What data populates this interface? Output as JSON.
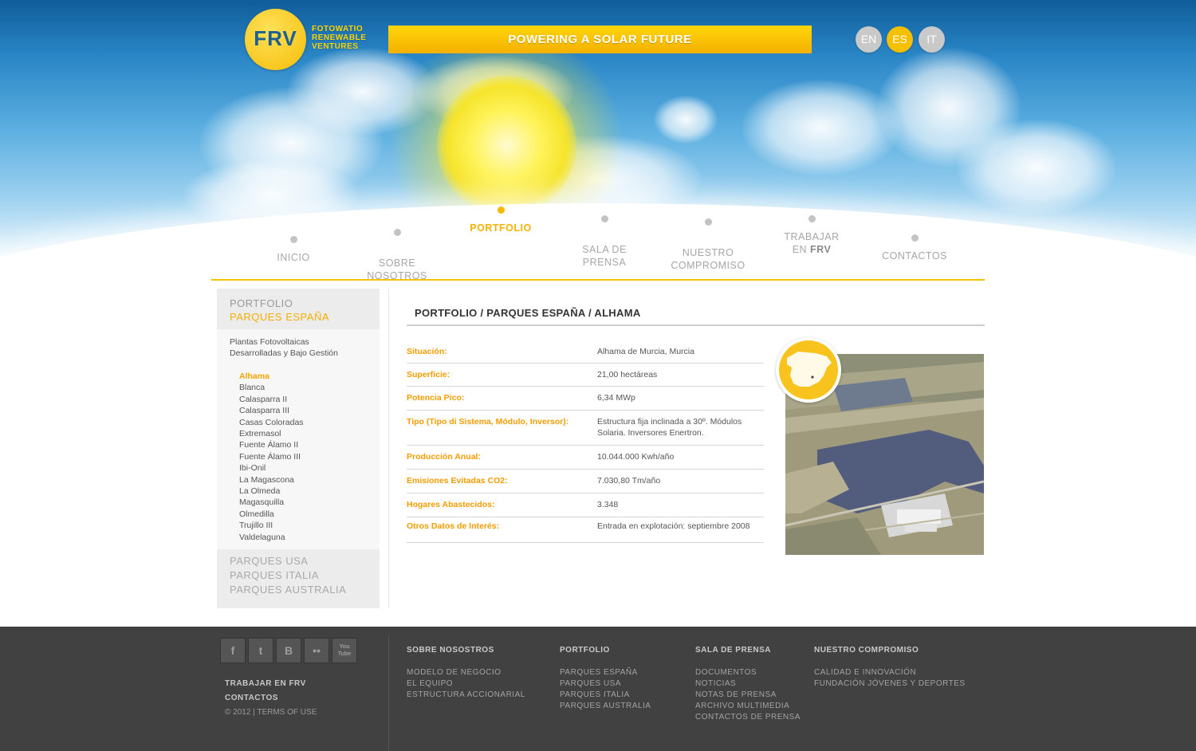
{
  "brand": {
    "mark": "FRV",
    "name_lines": [
      "FOTOWATIO",
      "RENEWABLE",
      "VENTURES"
    ],
    "colors": {
      "yellow": "#f6c000",
      "blue": "#1b5f93"
    }
  },
  "banner": "POWERING A SOLAR FUTURE",
  "languages": [
    {
      "label": "EN",
      "active": false
    },
    {
      "label": "ES",
      "active": true
    },
    {
      "label": "IT",
      "active": false
    }
  ],
  "nav": [
    {
      "label": "INICIO"
    },
    {
      "label": "SOBRE\nNOSOTROS"
    },
    {
      "label": "PORTFOLIO",
      "active": true
    },
    {
      "label": "SALA DE\nPRENSA"
    },
    {
      "label": "NUESTRO\nCOMPROMISO"
    },
    {
      "label_top": "TRABAJAR",
      "label_pre": "EN ",
      "label_bold": "FRV"
    },
    {
      "label": "CONTACTOS"
    }
  ],
  "sidebar": {
    "top": "PORTFOLIO",
    "current": "PARQUES ESPAÑA",
    "desc_lines": [
      "Plantas Fotovoltaicas",
      "Desarrolladas y Bajo Gestión"
    ],
    "items": [
      "Alhama",
      "Blanca",
      "Calasparra II",
      "Calasparra III",
      "Casas Coloradas",
      "Extremasol",
      "Fuente Álamo II",
      "Fuente Álamo III",
      "Ibi-Onil",
      "La Magascona",
      "La Olmeda",
      "Magasquilla",
      "Olmedilla",
      "Trujillo III",
      "Valdelaguna"
    ],
    "active_item": "Alhama",
    "other_sections": [
      "PARQUES USA",
      "PARQUES ITALIA",
      "PARQUES AUSTRALIA"
    ]
  },
  "main": {
    "title": "PORTFOLIO / PARQUES ESPAÑA / ALHAMA",
    "rows": [
      {
        "key": "Situación:",
        "value": "Alhama de Murcia, Murcia"
      },
      {
        "key": "Superficie:",
        "value": "21,00 hectáreas"
      },
      {
        "key": "Potencia Pico:",
        "value": "6,34 MWp"
      },
      {
        "key": "Tipo (Tipo di Sistema, Módulo, Inversor):",
        "value": "Estructura fija inclinada a 30º. Módulos Solaria. Inversores Enertron."
      },
      {
        "key": "Producción Anual:",
        "value": "10.044.000 Kwh/año"
      },
      {
        "key": "Emisiones Evitadas CO2:",
        "value": "7.030,80 Tm/año"
      },
      {
        "key": "Hogares Abastecidos:",
        "value": "3.348"
      },
      {
        "key": "Otros Datos de Interés:",
        "value": "Entrada en explotación: septiembre 2008"
      }
    ]
  },
  "footer": {
    "social": [
      {
        "icon": "facebook-icon",
        "glyph": "f"
      },
      {
        "icon": "twitter-icon",
        "glyph": "t"
      },
      {
        "icon": "blogger-icon",
        "glyph": "B"
      },
      {
        "icon": "flickr-icon",
        "glyph": "••"
      },
      {
        "icon": "youtube-icon",
        "glyph": "You\nTube"
      }
    ],
    "links": [
      "TRABAJAR EN FRV",
      "CONTACTOS"
    ],
    "copyright": "© 2012 | TERMS OF USE",
    "columns": [
      {
        "heading": "SOBRE NOSOSTROS",
        "links": [
          "MODELO DE NEGOCIO",
          "EL EQUIPO",
          "ESTRUCTURA ACCIONARIAL"
        ]
      },
      {
        "heading": "PORTFOLIO",
        "links": [
          "PARQUES ESPAÑA",
          "PARQUES USA",
          "PARQUES ITALIA",
          "PARQUES AUSTRALIA"
        ]
      },
      {
        "heading": "SALA DE PRENSA",
        "links": [
          "DOCUMENTOS",
          "NOTICIAS",
          "NOTAS DE PRENSA",
          "ARCHIVO MULTIMEDIA",
          "CONTACTOS DE PRENSA"
        ]
      },
      {
        "heading": "NUESTRO COMPROMISO",
        "links": [
          "CALIDAD E INNOVACIÓN",
          "FUNDACIÓN JÓVENES Y DEPORTES"
        ]
      }
    ]
  }
}
